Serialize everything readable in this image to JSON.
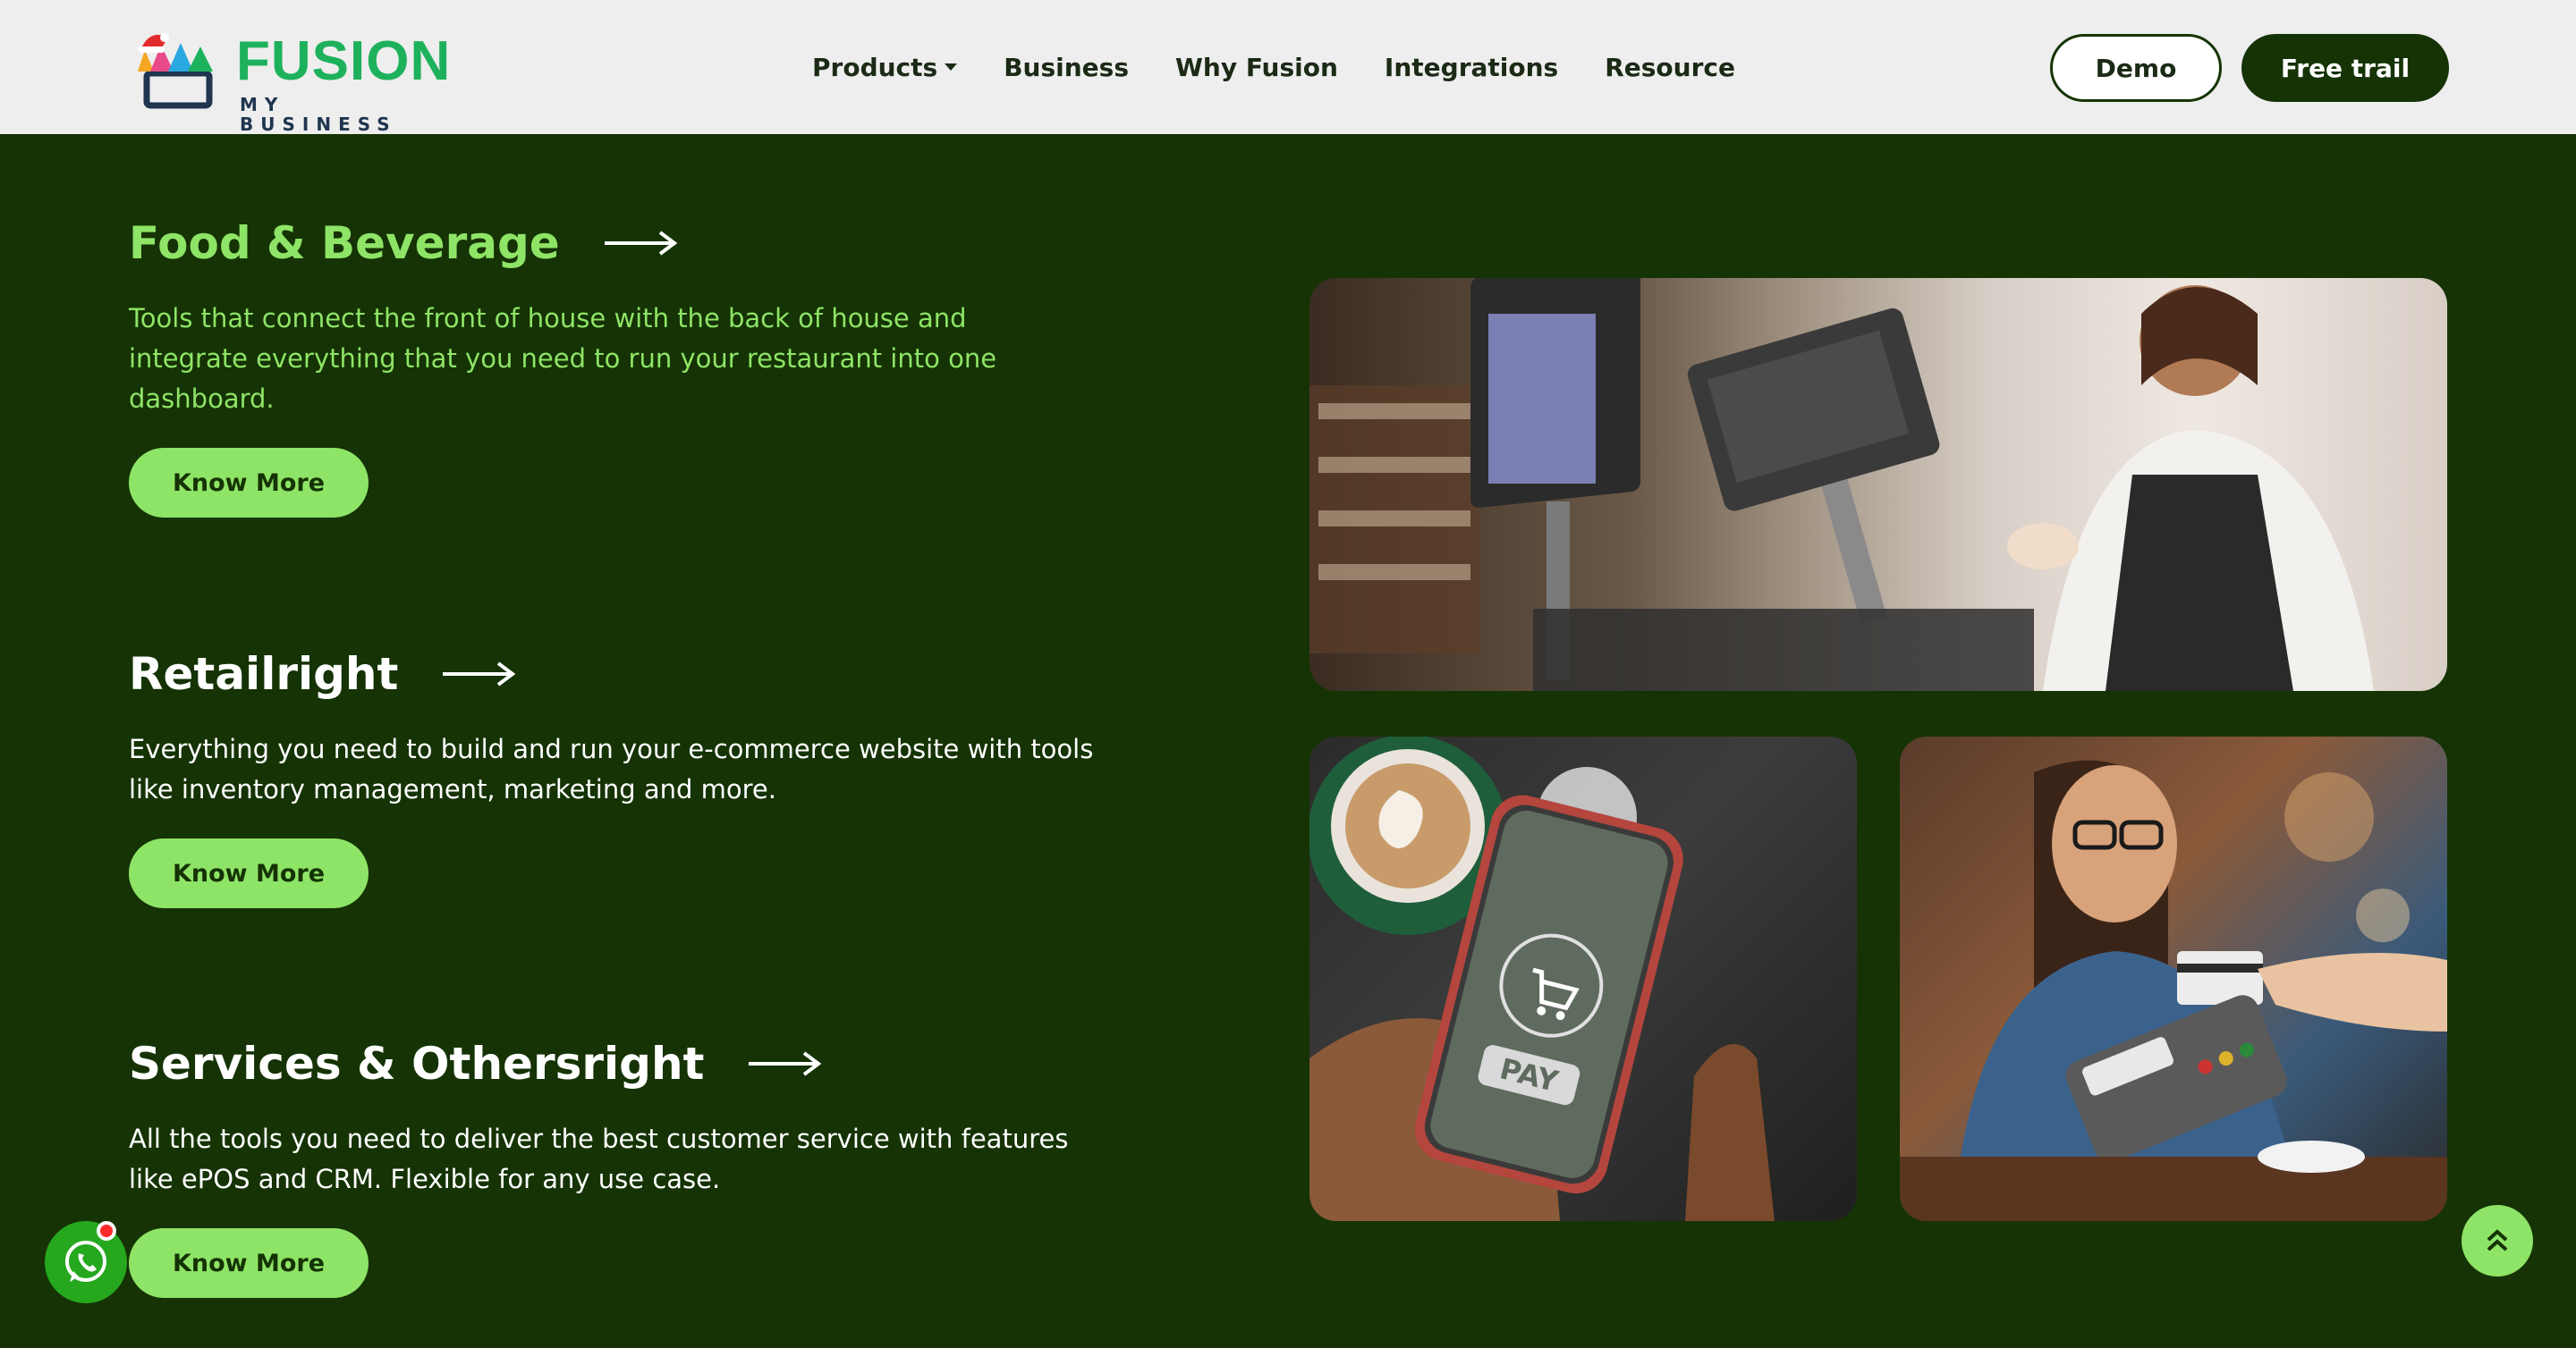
{
  "brand": {
    "name": "FUSION",
    "tagline": "MY BUSINESS",
    "colors": {
      "primary_green": "#1eb15c",
      "dark_green": "#153304",
      "light_green": "#8ee466"
    }
  },
  "nav": {
    "items": [
      {
        "label": "Products",
        "has_dropdown": true
      },
      {
        "label": "Business"
      },
      {
        "label": "Why Fusion"
      },
      {
        "label": "Integrations"
      },
      {
        "label": "Resource"
      }
    ],
    "demo_label": "Demo",
    "trial_label": "Free trail"
  },
  "sections": [
    {
      "title": "Food & Beverage",
      "description": "Tools that connect the front of house with the back of house and integrate everything that you need to run your restaurant into one dashboard.",
      "button": "Know More"
    },
    {
      "title": "Retailright",
      "description": "Everything you need to build and run your e-commerce website with tools like inventory management, marketing and more.",
      "button": "Know More"
    },
    {
      "title": "Services & Othersright",
      "description": "All the tools you need to deliver the best customer service with features like ePOS and CRM. Flexible for any use case.",
      "button": "Know More"
    }
  ],
  "images": {
    "pos_counter": {
      "icon": "pos-terminal-photo"
    },
    "mobile_pay": {
      "screen_text": "PAY",
      "icon": "cart-icon"
    },
    "card_payment": {
      "icon": "card-payment-photo"
    }
  },
  "floating": {
    "whatsapp_icon": "whatsapp-icon",
    "scroll_icon": "double-chevron-up-icon"
  }
}
